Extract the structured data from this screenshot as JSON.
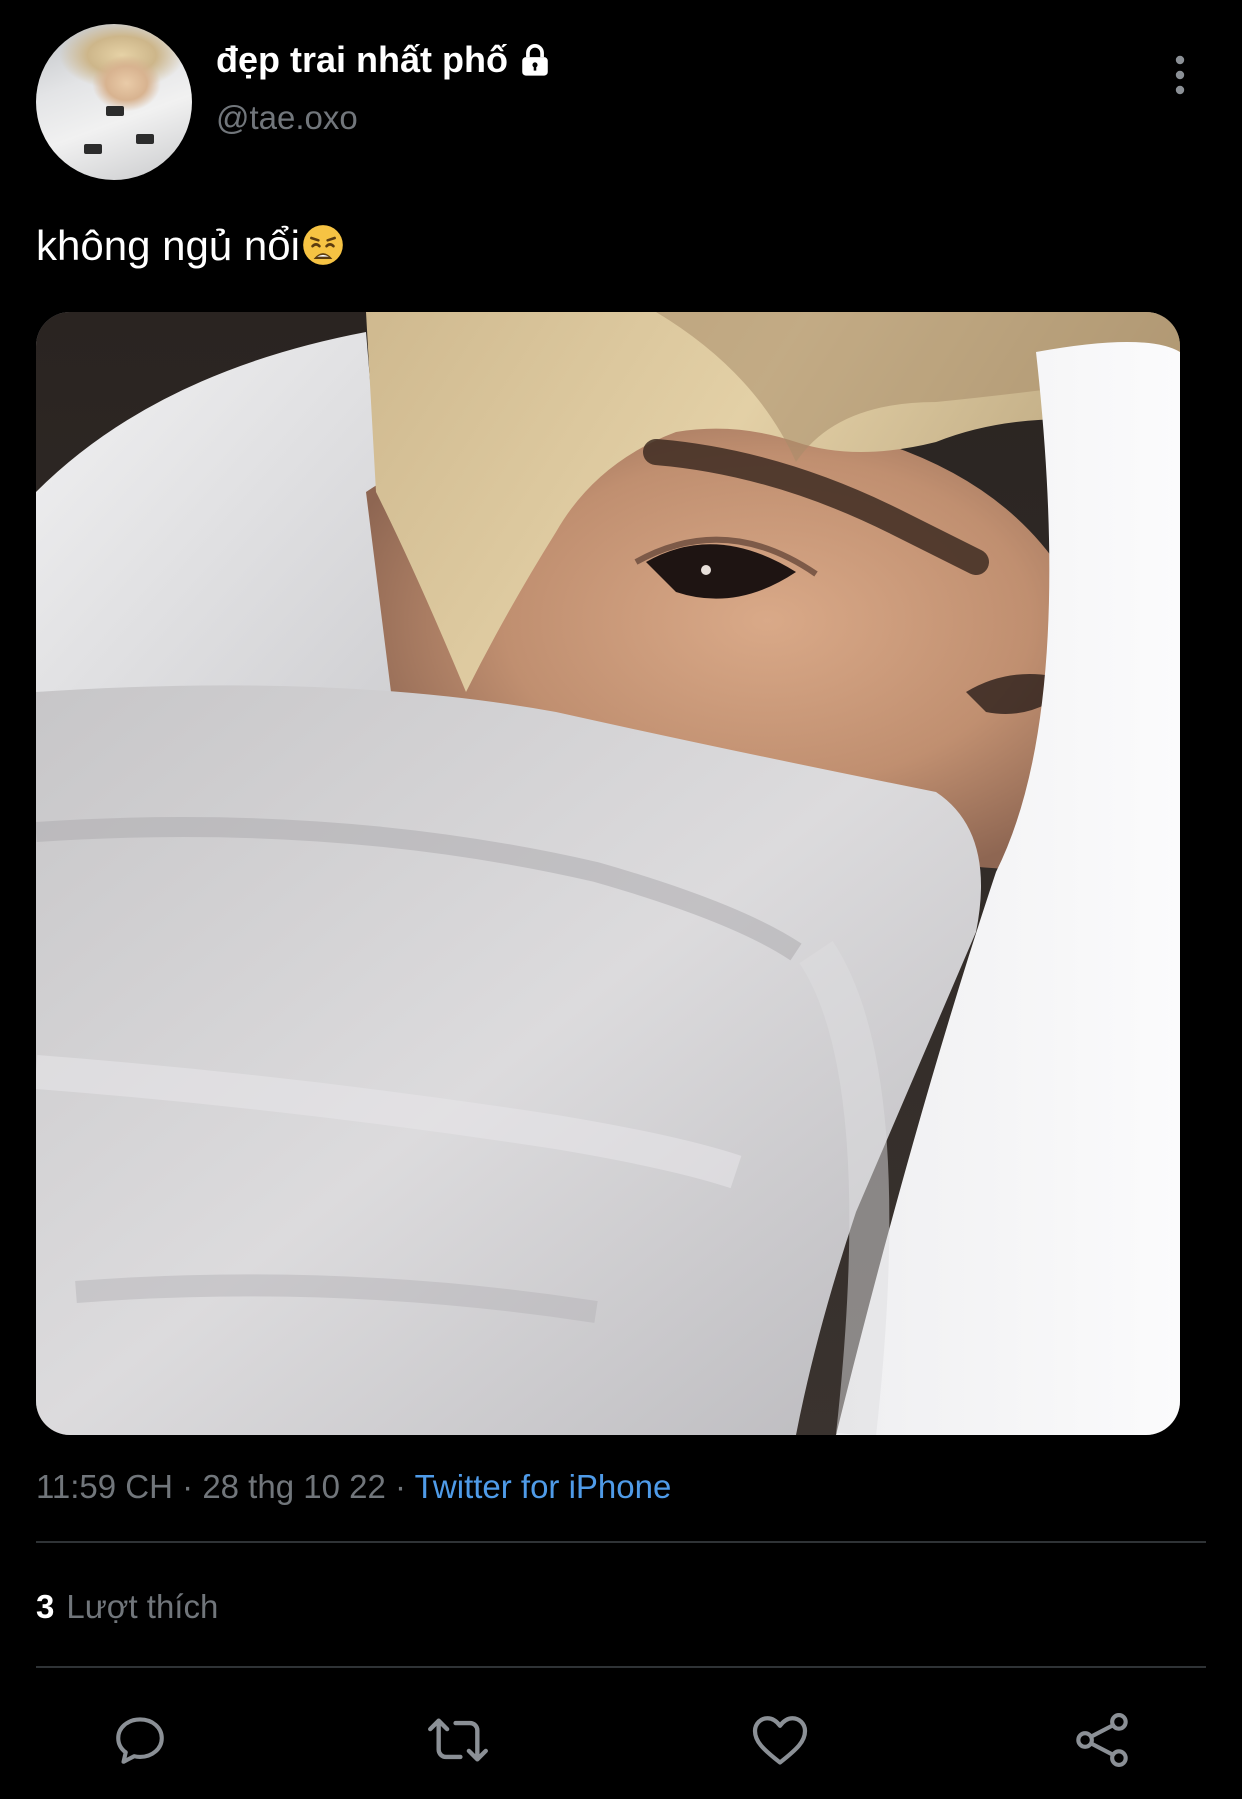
{
  "header": {
    "display_name": "đẹp trai nhất phố",
    "handle": "@tae.oxo",
    "avatar_icon": "avatar",
    "lock_icon": "lock-icon",
    "more_icon": "more-vertical-icon"
  },
  "tweet": {
    "text": "không ngủ nổi",
    "emoji": "weary-face-emoji"
  },
  "meta": {
    "time": "11:59 CH",
    "separator1": "·",
    "date": "28 thg 10 22",
    "separator2": "·",
    "source": "Twitter for iPhone"
  },
  "stats": {
    "likes_count": "3",
    "likes_label": "Lượt thích"
  },
  "actions": [
    {
      "name": "reply",
      "icon": "reply-icon"
    },
    {
      "name": "retweet",
      "icon": "retweet-icon"
    },
    {
      "name": "like",
      "icon": "heart-icon"
    },
    {
      "name": "share",
      "icon": "share-icon"
    }
  ],
  "colors": {
    "background": "#000000",
    "text_primary": "#ffffff",
    "text_secondary": "#71767b",
    "link": "#4f9be8",
    "divider": "#2f3336"
  }
}
